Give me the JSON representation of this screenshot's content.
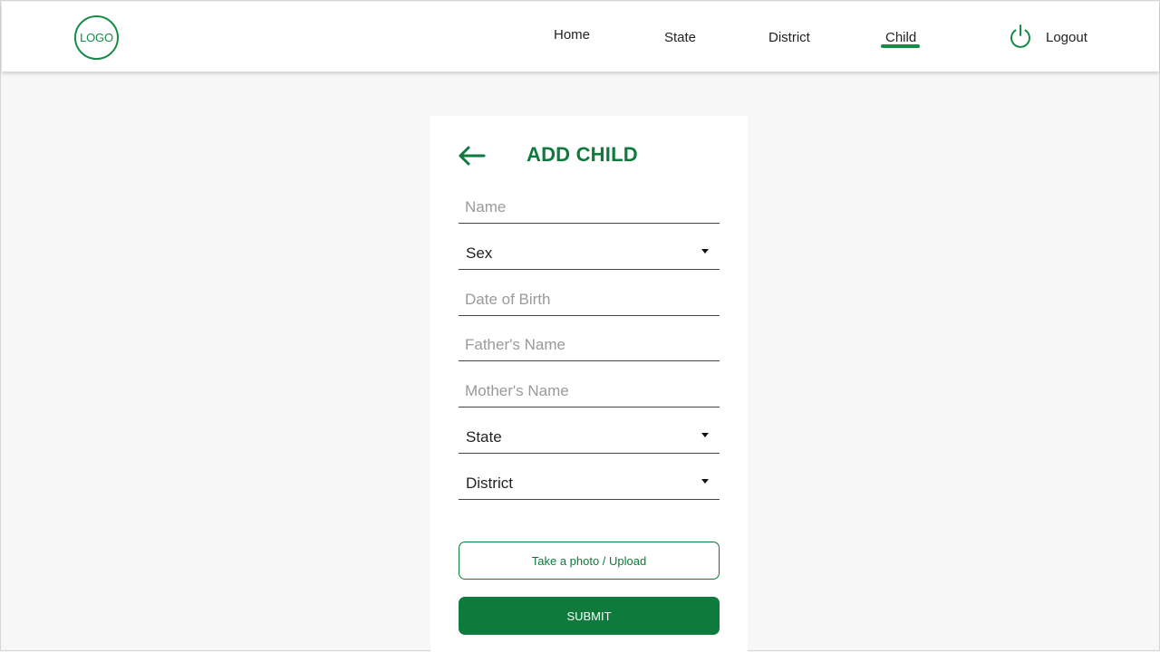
{
  "header": {
    "logo_text": "LOGO",
    "nav": {
      "home": "Home",
      "state": "State",
      "district": "District",
      "child": "Child",
      "logout": "Logout"
    },
    "active_tab": "Child",
    "icons": {
      "logout": "power-icon"
    }
  },
  "form": {
    "title": "ADD CHILD",
    "back_icon": "arrow-left-icon",
    "fields": {
      "name_placeholder": "Name",
      "sex_label": "Sex",
      "dob_placeholder": "Date of Birth",
      "father_placeholder": "Father's Name",
      "mother_placeholder": "Mother's Name",
      "state_label": "State",
      "district_label": "District"
    },
    "upload_label": "Take a photo / Upload",
    "submit_label": "SUBMIT"
  },
  "colors": {
    "brand_green": "#0e7a3b",
    "logo_green": "#168c47",
    "background": "#f7f7f7"
  }
}
